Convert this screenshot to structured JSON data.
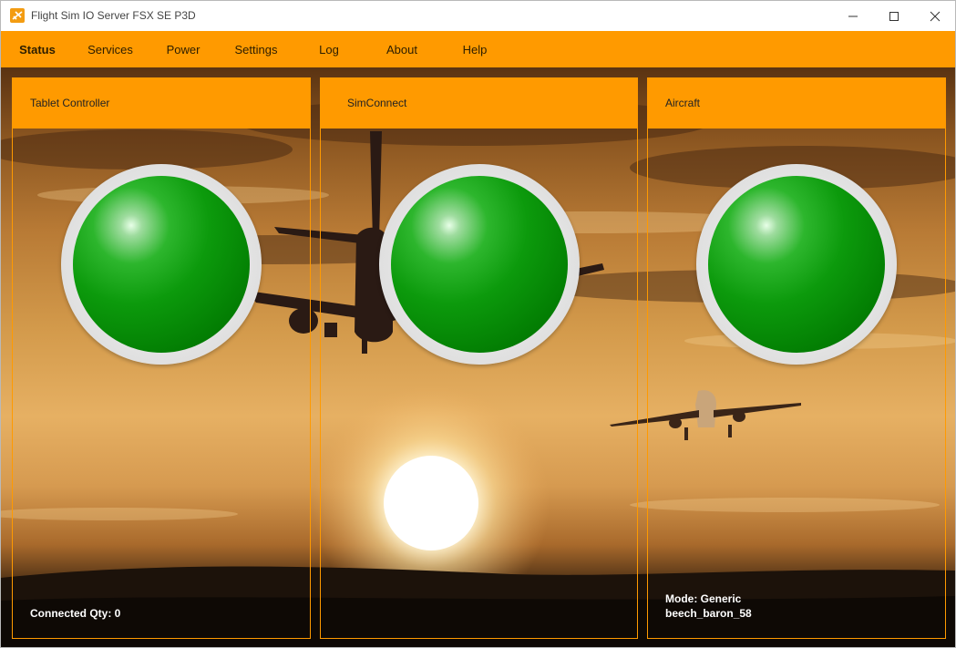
{
  "window": {
    "title": "Flight Sim IO Server FSX SE P3D",
    "controls": {
      "minimize_icon": "minimize-icon",
      "maximize_icon": "maximize-icon",
      "close_icon": "close-icon"
    }
  },
  "menu": {
    "items": [
      {
        "label": "Status",
        "active": true
      },
      {
        "label": "Services",
        "active": false
      },
      {
        "label": "Power",
        "active": false
      },
      {
        "label": "Settings",
        "active": false
      },
      {
        "label": "Log",
        "active": false
      },
      {
        "label": "About",
        "active": false
      },
      {
        "label": "Help",
        "active": false
      }
    ]
  },
  "colors": {
    "accent": "#ff9a00",
    "indicator_on": "#0c9a0c",
    "status_text": "#ffffff"
  },
  "panels": {
    "tablet": {
      "title": "Tablet Controller",
      "indicator_state": "green",
      "status": "Connected Qty: 0"
    },
    "simconnect": {
      "title": "SimConnect",
      "indicator_state": "green"
    },
    "aircraft": {
      "title": "Aircraft",
      "indicator_state": "green",
      "mode": "Mode: Generic",
      "aircraft_name": "beech_baron_58"
    }
  }
}
